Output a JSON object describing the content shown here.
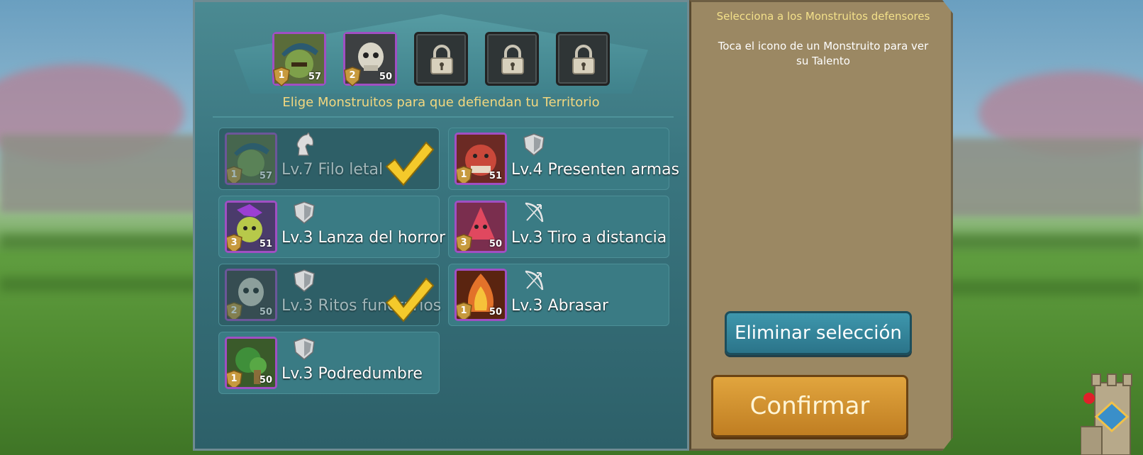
{
  "panel": {
    "subtitle": "Elige Monstruitos para que defiendan tu Territorio"
  },
  "defender_slots": [
    {
      "rank": "1",
      "level": "57"
    },
    {
      "rank": "2",
      "level": "50"
    },
    {
      "locked": true
    },
    {
      "locked": true
    },
    {
      "locked": true
    }
  ],
  "familiars": [
    {
      "name": "Lv.7 Filo letal",
      "rank": "1",
      "level": "57",
      "type": "horse-icon",
      "selected": true
    },
    {
      "name": "Lv.4 Presenten armas",
      "rank": "1",
      "level": "51",
      "type": "shield-icon",
      "selected": false
    },
    {
      "name": "Lv.3 Lanza del horror",
      "rank": "3",
      "level": "51",
      "type": "shield-icon",
      "selected": false
    },
    {
      "name": "Lv.3 Tiro a distancia",
      "rank": "3",
      "level": "50",
      "type": "bow-icon",
      "selected": false
    },
    {
      "name": "Lv.3 Ritos funerarios",
      "rank": "2",
      "level": "50",
      "type": "shield-icon",
      "selected": true
    },
    {
      "name": "Lv.3 Abrasar",
      "rank": "1",
      "level": "50",
      "type": "bow-icon",
      "selected": false
    },
    {
      "name": "Lv.3 Podredumbre",
      "rank": "1",
      "level": "50",
      "type": "shield-icon",
      "selected": false
    }
  ],
  "side": {
    "title": "Selecciona a los Monstruitos defensores",
    "hint": "Toca el icono de un Monstruito para ver su Talento",
    "clear_label": "Eliminar selección",
    "confirm_label": "Confirmar"
  },
  "colors": {
    "panel": "#3a7680",
    "side": "#9b8863",
    "confirm": "#d0922f",
    "clear": "#3389a0",
    "frame_purple": "#a04fc3",
    "gold_text": "#f2d77f"
  }
}
